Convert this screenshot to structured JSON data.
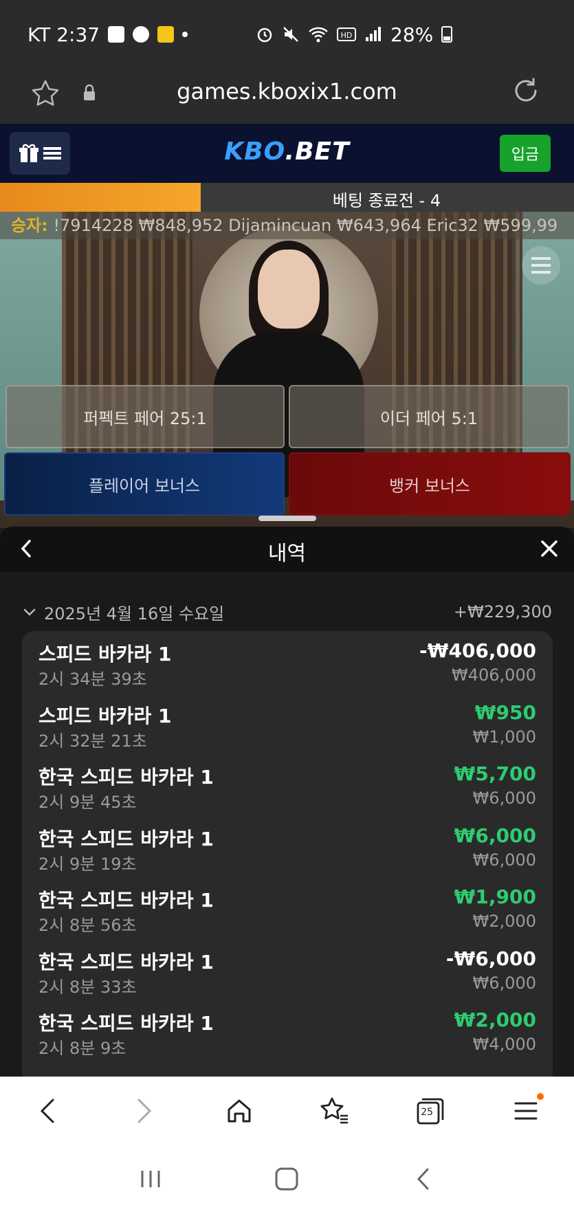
{
  "status_bar": {
    "carrier_time": "KT 2:37",
    "battery": "28%"
  },
  "address_bar": {
    "url": "games.kboxix1.com"
  },
  "site_header": {
    "logo_part1": "KBO",
    "logo_part2": ".BET",
    "deposit_label": "입금"
  },
  "bet_timer": {
    "label": "베팅 종료전 - 4",
    "progress_fraction": 0.35
  },
  "ticker": {
    "label": "승자:",
    "text": "!7914228   ₩848,952 Dijamincuan   ₩643,964 Eric32   ₩599,99"
  },
  "bets": {
    "perfect_pair": "퍼펙트 페어 25:1",
    "either_pair": "이더 페어 5:1",
    "player_bonus": "플레이어 보너스",
    "banker_bonus": "뱅커 보너스"
  },
  "history": {
    "title": "내역",
    "date": "2025년 4월 16일 수요일",
    "date_total": "+₩229,300",
    "rows": [
      {
        "game": "스피드 바카라 1",
        "time": "2시 34분 39초",
        "amount": "-₩406,000",
        "stake": "₩406,000",
        "result": "loss"
      },
      {
        "game": "스피드 바카라 1",
        "time": "2시 32분 21초",
        "amount": "₩950",
        "stake": "₩1,000",
        "result": "win"
      },
      {
        "game": "한국 스피드 바카라 1",
        "time": "2시 9분 45초",
        "amount": "₩5,700",
        "stake": "₩6,000",
        "result": "win"
      },
      {
        "game": "한국 스피드 바카라 1",
        "time": "2시 9분 19초",
        "amount": "₩6,000",
        "stake": "₩6,000",
        "result": "win"
      },
      {
        "game": "한국 스피드 바카라 1",
        "time": "2시 8분 56초",
        "amount": "₩1,900",
        "stake": "₩2,000",
        "result": "win"
      },
      {
        "game": "한국 스피드 바카라 1",
        "time": "2시 8분 33초",
        "amount": "-₩6,000",
        "stake": "₩6,000",
        "result": "loss"
      },
      {
        "game": "한국 스피드 바카라 1",
        "time": "2시 8분 9초",
        "amount": "₩2,000",
        "stake": "₩4,000",
        "result": "win"
      }
    ]
  },
  "browser_nav": {
    "tabs_count": "25"
  },
  "colors": {
    "win": "#2ecc71",
    "loss": "#ffffff",
    "deposit": "#17a32b",
    "logo_blue": "#3aa0ff",
    "timer_orange": "#f4a62a"
  }
}
